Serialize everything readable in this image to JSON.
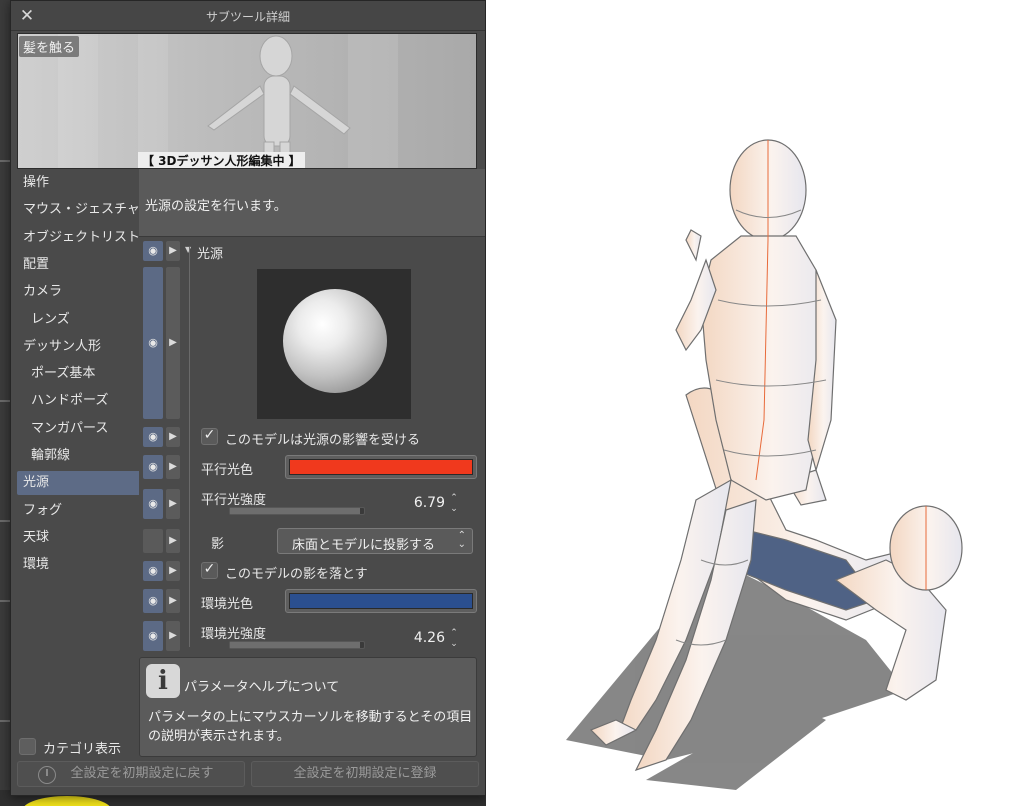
{
  "window": {
    "title": "サブツール詳細",
    "close_glyph": "✕"
  },
  "preview": {
    "label": "髪を触る",
    "caption": "【 3Dデッサン人形編集中 】"
  },
  "categories": [
    {
      "label": "操作",
      "sub": false,
      "selected": false
    },
    {
      "label": "マウス・ジェスチャー",
      "sub": false,
      "selected": false
    },
    {
      "label": "オブジェクトリスト",
      "sub": false,
      "selected": false
    },
    {
      "label": "配置",
      "sub": false,
      "selected": false
    },
    {
      "label": "カメラ",
      "sub": false,
      "selected": false
    },
    {
      "label": "レンズ",
      "sub": true,
      "selected": false
    },
    {
      "label": "デッサン人形",
      "sub": false,
      "selected": false
    },
    {
      "label": "ポーズ基本",
      "sub": true,
      "selected": false
    },
    {
      "label": "ハンドポーズ",
      "sub": true,
      "selected": false
    },
    {
      "label": "マンガパース",
      "sub": true,
      "selected": false
    },
    {
      "label": "輪郭線",
      "sub": true,
      "selected": false
    },
    {
      "label": "光源",
      "sub": false,
      "selected": true
    },
    {
      "label": "フォグ",
      "sub": false,
      "selected": false
    },
    {
      "label": "天球",
      "sub": false,
      "selected": false
    },
    {
      "label": "環境",
      "sub": false,
      "selected": false
    }
  ],
  "category_toggle": {
    "label": "カテゴリ表示",
    "checked": false
  },
  "description": "光源の設定を行います。",
  "settings": {
    "section_title": "光源",
    "receive_light": {
      "label": "このモデルは光源の影響を受ける",
      "checked": true
    },
    "parallel_color": {
      "label": "平行光色",
      "color": "#f0391d"
    },
    "parallel_strength": {
      "label": "平行光強度",
      "value": "6.79",
      "fill_ratio": 0.97
    },
    "shadow": {
      "label": "影",
      "value": "床面とモデルに投影する"
    },
    "cast_shadow": {
      "label": "このモデルの影を落とす",
      "checked": true
    },
    "ambient_color": {
      "label": "環境光色",
      "color": "#2b4f8f"
    },
    "ambient_strength": {
      "label": "環境光強度",
      "value": "4.26",
      "fill_ratio": 0.97
    }
  },
  "help": {
    "title": "パラメータヘルプについて",
    "body": "パラメータの上にマウスカーソルを移動するとその項目の説明が表示されます。"
  },
  "footer": {
    "reset_label": "全設定を初期設定に戻す",
    "register_label": "全設定を初期設定に登録"
  },
  "icons": {
    "eye": "◉",
    "arrow": "▶",
    "checkmark": "✓",
    "info": "i",
    "spin_up": "⌃",
    "spin_down": "⌄"
  },
  "colors": {
    "selection": "#5d6b86",
    "dialog_bg": "#4a4a4a"
  }
}
